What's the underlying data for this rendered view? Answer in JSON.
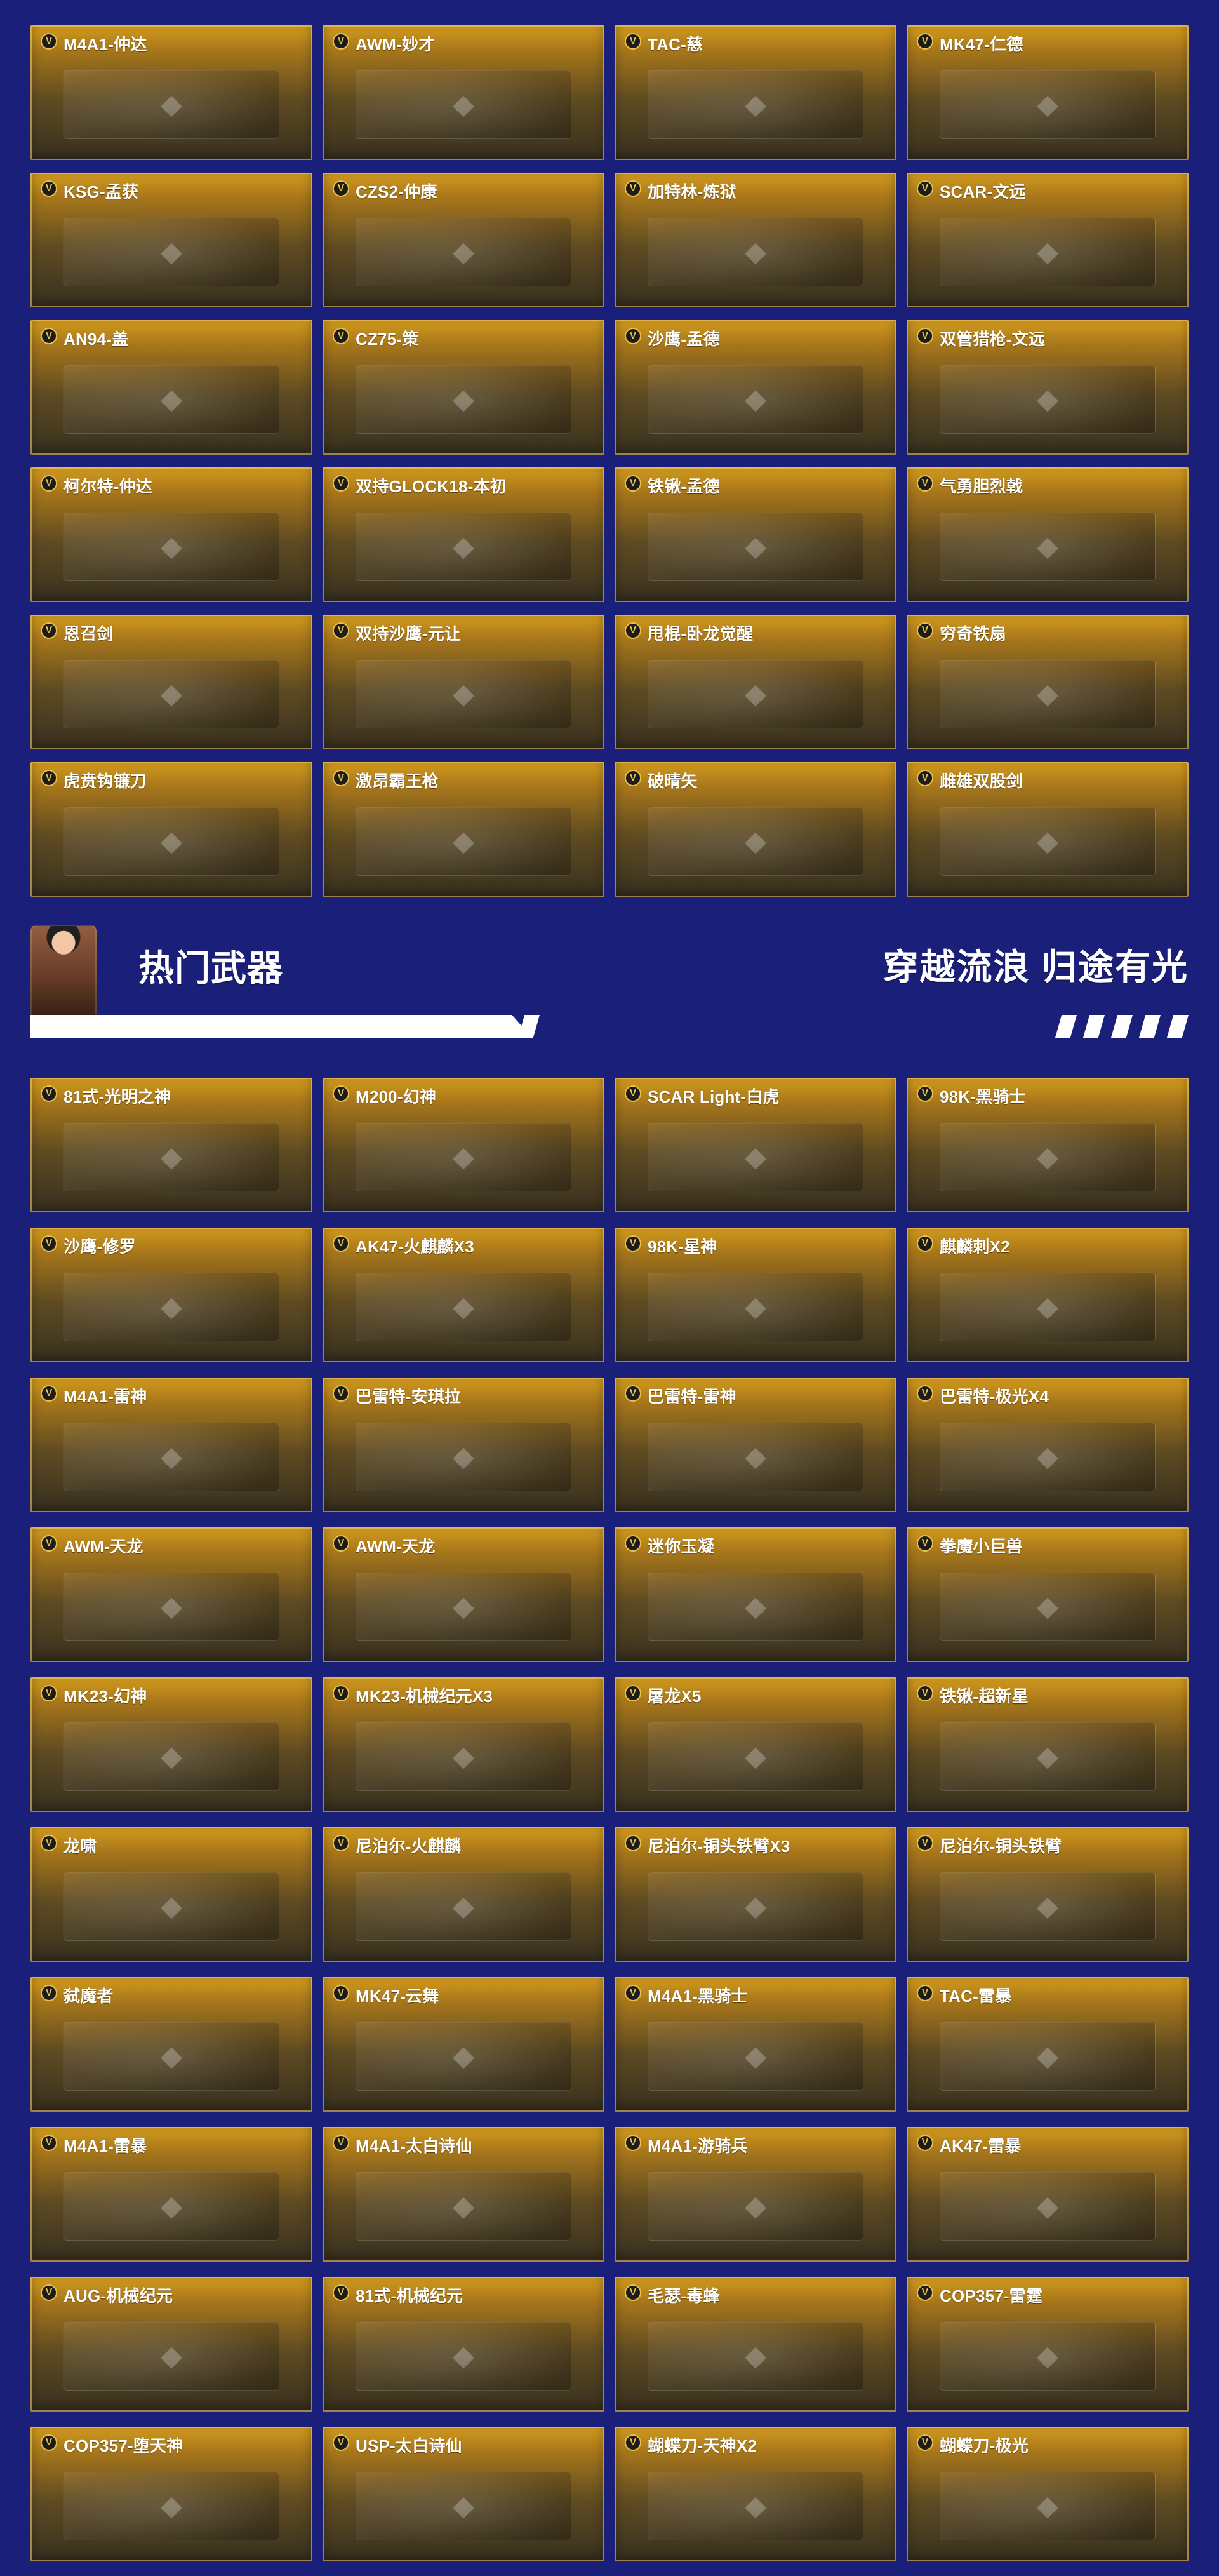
{
  "badges": {
    "v_label": "V"
  },
  "header": {
    "title": "热门武器",
    "slogan": "穿越流浪 归途有光"
  },
  "grids": {
    "top": {
      "cards": [
        {
          "label": "M4A1-仲达",
          "icon": "rifle-icon"
        },
        {
          "label": "AWM-妙才",
          "icon": "sniper-icon"
        },
        {
          "label": "TAC-慈",
          "icon": "rifle-icon"
        },
        {
          "label": "MK47-仁德",
          "icon": "rifle-icon"
        },
        {
          "label": "KSG-孟获",
          "icon": "shotgun-icon"
        },
        {
          "label": "CZS2-仲康",
          "icon": "smg-icon"
        },
        {
          "label": "加特林-炼狱",
          "icon": "gatling-icon"
        },
        {
          "label": "SCAR-文远",
          "icon": "rifle-icon"
        },
        {
          "label": "AN94-盖",
          "icon": "rifle-icon"
        },
        {
          "label": "CZ75-策",
          "icon": "pistol-icon"
        },
        {
          "label": "沙鹰-孟德",
          "icon": "pistol-icon"
        },
        {
          "label": "双管猎枪-文远",
          "icon": "shotgun-icon"
        },
        {
          "label": "柯尔特-仲达",
          "icon": "pistol-icon"
        },
        {
          "label": "双持GLOCK18-本初",
          "icon": "pistol-icon"
        },
        {
          "label": "铁锹-孟德",
          "icon": "melee-icon"
        },
        {
          "label": "气勇胆烈戟",
          "icon": "halberd-icon"
        },
        {
          "label": "恩召剑",
          "icon": "sword-icon"
        },
        {
          "label": "双持沙鹰-元让",
          "icon": "pistol-icon"
        },
        {
          "label": "甩棍-卧龙觉醒",
          "icon": "baton-icon"
        },
        {
          "label": "穷奇铁扇",
          "icon": "fan-icon"
        },
        {
          "label": "虎贲钩镰刀",
          "icon": "scythe-icon"
        },
        {
          "label": "激昂霸王枪",
          "icon": "spear-icon"
        },
        {
          "label": "破晴矢",
          "icon": "arrow-icon"
        },
        {
          "label": "雌雄双股剑",
          "icon": "sword-icon"
        }
      ]
    },
    "bottom": {
      "cards": [
        {
          "label": "81式-光明之神",
          "icon": "rifle-icon"
        },
        {
          "label": "M200-幻神",
          "icon": "sniper-icon"
        },
        {
          "label": "SCAR Light-白虎",
          "icon": "rifle-icon"
        },
        {
          "label": "98K-黑骑士",
          "icon": "sniper-icon"
        },
        {
          "label": "沙鹰-修罗",
          "icon": "pistol-icon"
        },
        {
          "label": "AK47-火麒麟X3",
          "icon": "rifle-icon"
        },
        {
          "label": "98K-星神",
          "icon": "sniper-icon"
        },
        {
          "label": "麒麟刺X2",
          "icon": "melee-icon"
        },
        {
          "label": "M4A1-雷神",
          "icon": "rifle-icon"
        },
        {
          "label": "巴雷特-安琪拉",
          "icon": "sniper-icon"
        },
        {
          "label": "巴雷特-雷神",
          "icon": "sniper-icon"
        },
        {
          "label": "巴雷特-极光X4",
          "icon": "sniper-icon"
        },
        {
          "label": "AWM-天龙",
          "icon": "sniper-icon"
        },
        {
          "label": "AWM-天龙",
          "icon": "sniper-icon"
        },
        {
          "label": "迷你玉凝",
          "icon": "character-icon"
        },
        {
          "label": "拳魔小巨兽",
          "icon": "character-icon"
        },
        {
          "label": "MK23-幻神",
          "icon": "pistol-icon"
        },
        {
          "label": "MK23-机械纪元X3",
          "icon": "pistol-icon"
        },
        {
          "label": "屠龙X5",
          "icon": "blade-icon"
        },
        {
          "label": "铁锹-超新星",
          "icon": "melee-icon"
        },
        {
          "label": "龙啸",
          "icon": "blade-icon"
        },
        {
          "label": "尼泊尔-火麒麟",
          "icon": "knife-icon"
        },
        {
          "label": "尼泊尔-铜头铁臂X3",
          "icon": "character-icon"
        },
        {
          "label": "尼泊尔-铜头铁臂",
          "icon": "character-icon"
        },
        {
          "label": "弑魔者",
          "icon": "melee-icon"
        },
        {
          "label": "MK47-云舞",
          "icon": "rifle-icon"
        },
        {
          "label": "M4A1-黑骑士",
          "icon": "rifle-icon"
        },
        {
          "label": "TAC-雷暴",
          "icon": "rifle-icon"
        },
        {
          "label": "M4A1-雷暴",
          "icon": "rifle-icon"
        },
        {
          "label": "M4A1-太白诗仙",
          "icon": "rifle-icon"
        },
        {
          "label": "M4A1-游骑兵",
          "icon": "rifle-icon"
        },
        {
          "label": "AK47-雷暴",
          "icon": "rifle-icon"
        },
        {
          "label": "AUG-机械纪元",
          "icon": "rifle-icon"
        },
        {
          "label": "81式-机械纪元",
          "icon": "rifle-icon"
        },
        {
          "label": "毛瑟-毒蜂",
          "icon": "pistol-icon"
        },
        {
          "label": "COP357-雷霆",
          "icon": "pistol-icon"
        },
        {
          "label": "COP357-堕天神",
          "icon": "pistol-icon"
        },
        {
          "label": "USP-太白诗仙",
          "icon": "pistol-icon"
        },
        {
          "label": "蝴蝶刀-天神X2",
          "icon": "knife-icon"
        },
        {
          "label": "蝴蝶刀-极光",
          "icon": "knife-icon"
        }
      ]
    }
  },
  "colors": {
    "background": "#1a1f7a",
    "card_gold_top": "#d39c1e",
    "card_bottom": "#37301f",
    "badge_gold": "#e7bf4a",
    "text": "#ffffff"
  }
}
